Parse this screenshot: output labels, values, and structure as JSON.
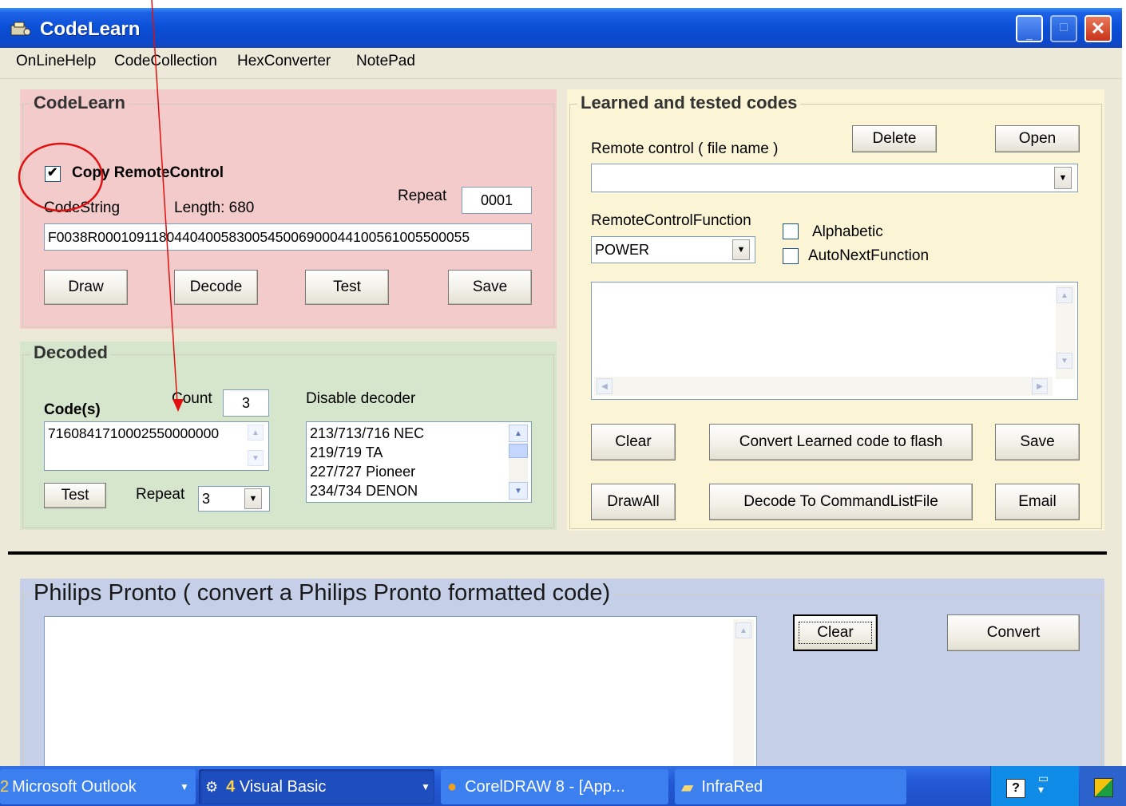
{
  "window": {
    "title": "CodeLearn"
  },
  "menu": [
    "OnLineHelp",
    "CodeCollection",
    "HexConverter",
    "NotePad"
  ],
  "codelearn": {
    "legend": "CodeLearn",
    "copy_label": "Copy RemoteControl",
    "copy_checked": true,
    "codestring_label": "CodeString",
    "length_label": "Length: 680",
    "repeat_label": "Repeat",
    "repeat_value": "0001",
    "codestring_value": "F0038R000109118044040058300545006900044100561005500055",
    "buttons": {
      "draw": "Draw",
      "decode": "Decode",
      "test": "Test",
      "save": "Save"
    }
  },
  "decoded": {
    "legend": "Decoded",
    "count_label": "Count",
    "count_value": "3",
    "codes_label": "Code(s)",
    "codes_value": "7160841710002550000000",
    "disable_label": "Disable decoder",
    "decoders": [
      "213/713/716 NEC",
      "219/719 TA",
      "227/727 Pioneer",
      "234/734 DENON"
    ],
    "test_button": "Test",
    "repeat_label": "Repeat",
    "repeat_value": "3"
  },
  "learned": {
    "legend": "Learned and tested codes",
    "delete_button": "Delete",
    "open_button": "Open",
    "remote_label": "Remote control ( file name )",
    "remote_value": "",
    "function_label": "RemoteControlFunction",
    "function_value": "POWER",
    "alphabetic_label": "Alphabetic",
    "autonext_label": "AutoNextFunction",
    "buttons": {
      "clear": "Clear",
      "convert_flash": "Convert Learned code to flash",
      "save": "Save",
      "drawall": "DrawAll",
      "decode_cmd": "Decode To CommandListFile",
      "email": "Email"
    }
  },
  "pronto": {
    "legend": "Philips Pronto ( convert a Philips Pronto formatted code)",
    "text": "",
    "clear_button": "Clear",
    "convert_button": "Convert"
  },
  "taskbar": {
    "items": [
      "2 Microsoft Outlook",
      "4 Visual Basic",
      "CorelDRAW 8 - [App...",
      "InfraRed"
    ]
  },
  "colors": {
    "codelearn_bg": "#f4cbcb",
    "decoded_bg": "#d6e6cc",
    "learned_bg": "#fbf5d6",
    "pronto_bg": "#c5d0e8",
    "annotation": "#e01010"
  }
}
